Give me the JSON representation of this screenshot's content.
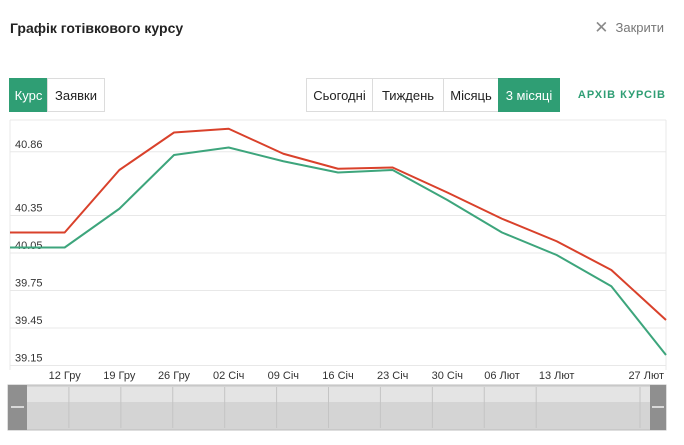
{
  "header": {
    "title": "Графік готівкового курсу",
    "close_label": "Закрити"
  },
  "left_tabs": [
    {
      "label": "Курс",
      "active": true
    },
    {
      "label": "Заявки",
      "active": false
    }
  ],
  "period_tabs": [
    {
      "label": "Сьогодні",
      "active": false
    },
    {
      "label": "Тиждень",
      "active": false
    },
    {
      "label": "Місяць",
      "active": false
    },
    {
      "label": "3 місяці",
      "active": true
    }
  ],
  "archive_link": "АРХІВ КУРСІВ",
  "colors": {
    "accent": "#2f9e74",
    "sell_line": "#d9412b",
    "buy_line": "#3da57c"
  },
  "chart_data": {
    "type": "line",
    "ytick_labels": [
      "40.86",
      "40.35",
      "40.05",
      "39.75",
      "39.45",
      "39.15"
    ],
    "ytick_values": [
      40.86,
      40.35,
      40.05,
      39.75,
      39.45,
      39.15
    ],
    "ylim": [
      39.05,
      41.05
    ],
    "x": [
      "12 Гру",
      "19 Гру",
      "26 Гру",
      "02 Січ",
      "09 Січ",
      "16 Січ",
      "23 Січ",
      "30 Січ",
      "06 Лют",
      "13 Лют",
      "27 Лют"
    ],
    "series": [
      {
        "values": [
          40.15,
          40.15,
          40.65,
          40.95,
          40.98,
          40.78,
          40.66,
          40.67,
          40.47,
          40.26,
          40.08,
          39.85,
          39.45
        ]
      },
      {
        "values": [
          40.03,
          40.03,
          40.34,
          40.77,
          40.83,
          40.72,
          40.63,
          40.65,
          40.41,
          40.15,
          39.97,
          39.72,
          39.17
        ]
      }
    ],
    "grid": true
  }
}
